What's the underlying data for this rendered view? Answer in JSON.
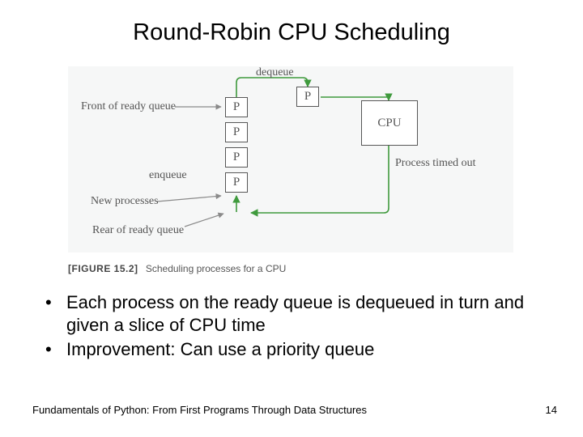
{
  "title": "Round-Robin CPU Scheduling",
  "diagram": {
    "labels": {
      "dequeue": "dequeue",
      "front_of_ready_queue": "Front of ready queue",
      "enqueue": "enqueue",
      "new_processes": "New processes",
      "rear_of_ready_queue": "Rear of ready queue",
      "process_timed_out": "Process timed out",
      "cpu": "CPU",
      "p": "P"
    }
  },
  "figure_caption": {
    "label": "[FIGURE 15.2]",
    "text": "Scheduling processes for a CPU"
  },
  "bullets": [
    "Each process on the ready queue is dequeued in turn and given a slice of CPU time",
    "Improvement: Can use a priority queue"
  ],
  "footer": {
    "left": "Fundamentals of Python: From First Programs Through Data Structures",
    "right": "14"
  }
}
